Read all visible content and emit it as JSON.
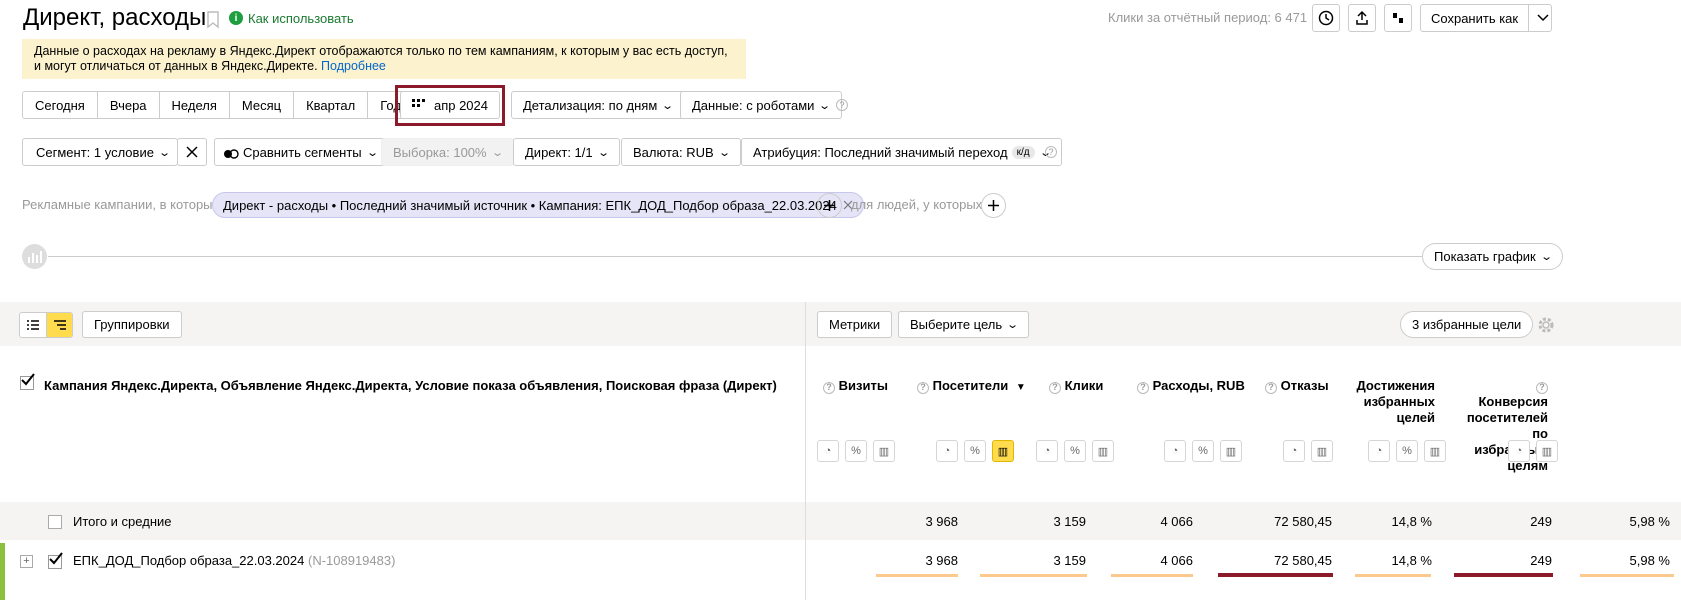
{
  "header": {
    "title": "Директ, расходы",
    "how_to": "Как использовать",
    "clicks_period": "Клики за отчётный период: 6 471",
    "save_as": "Сохранить как"
  },
  "notice": {
    "text": "Данные о расходах на рекламу в Яндекс.Директ отображаются только по тем кампаниям, к которым у вас есть доступ, и могут отличаться от данных в Яндекс.Директе.",
    "link": "Подробнее"
  },
  "periods": [
    "Сегодня",
    "Вчера",
    "Неделя",
    "Месяц",
    "Квартал",
    "Год"
  ],
  "date_picker": "апр 2024",
  "detail": "Детализация: по дням",
  "data_filter": "Данные: с роботами",
  "filters": {
    "segment": "Сегмент: 1 условие",
    "compare": "Сравнить сегменты",
    "sample": "Выборка: 100%",
    "direct": "Директ: 1/1",
    "currency": "Валюта: RUB",
    "attribution": "Атрибуция: Последний значимый переход",
    "attribution_badge": "к/д"
  },
  "campaign_filter": {
    "prefix": "Рекламные кампании, в которых",
    "chip": "Директ - расходы • Последний значимый источник • Кампания: ЕПК_ДОД_Подбор образа_22.03.2024",
    "suffix": "для людей, у которых"
  },
  "chart_toggle": "Показать график",
  "table_toolbar": {
    "groupings": "Группировки",
    "metrics": "Метрики",
    "choose_goal": "Выберите цель",
    "favorite_goals": "3 избранные цели"
  },
  "table": {
    "dimension_header": "Кампания Яндекс.Директа, Объявление Яндекс.Директа, Условие показа объявления, Поисковая фраза (Директ)",
    "columns": [
      "Визиты",
      "Посетители",
      "Клики",
      "Расходы, RUB",
      "Отказы",
      "Достижения избранных целей",
      "Конверсия посетителей по избранным целям"
    ],
    "sort_arrow": "▼",
    "total_label": "Итого и средние",
    "total_values": [
      "3 968",
      "3 159",
      "4 066",
      "72 580,45",
      "14,8 %",
      "249",
      "5,98 %"
    ],
    "row_name": "ЕПК_ДОД_Подбор образа_22.03.2024",
    "row_id": "(N-108919483)",
    "row_values": [
      "3 968",
      "3 159",
      "4 066",
      "72 580,45",
      "14,8 %",
      "249",
      "5,98 %"
    ],
    "row_bar_fraction": [
      1,
      1,
      1,
      1,
      1,
      1,
      1
    ]
  },
  "colors": {
    "highlight": "#8b1a2b",
    "notice_bg": "#fcf2ce",
    "chip_bg": "#e5e5f7",
    "active_yellow": "#ffdb4d",
    "row_bar": "#fcc98f",
    "row_marker": "#8ac23f"
  }
}
